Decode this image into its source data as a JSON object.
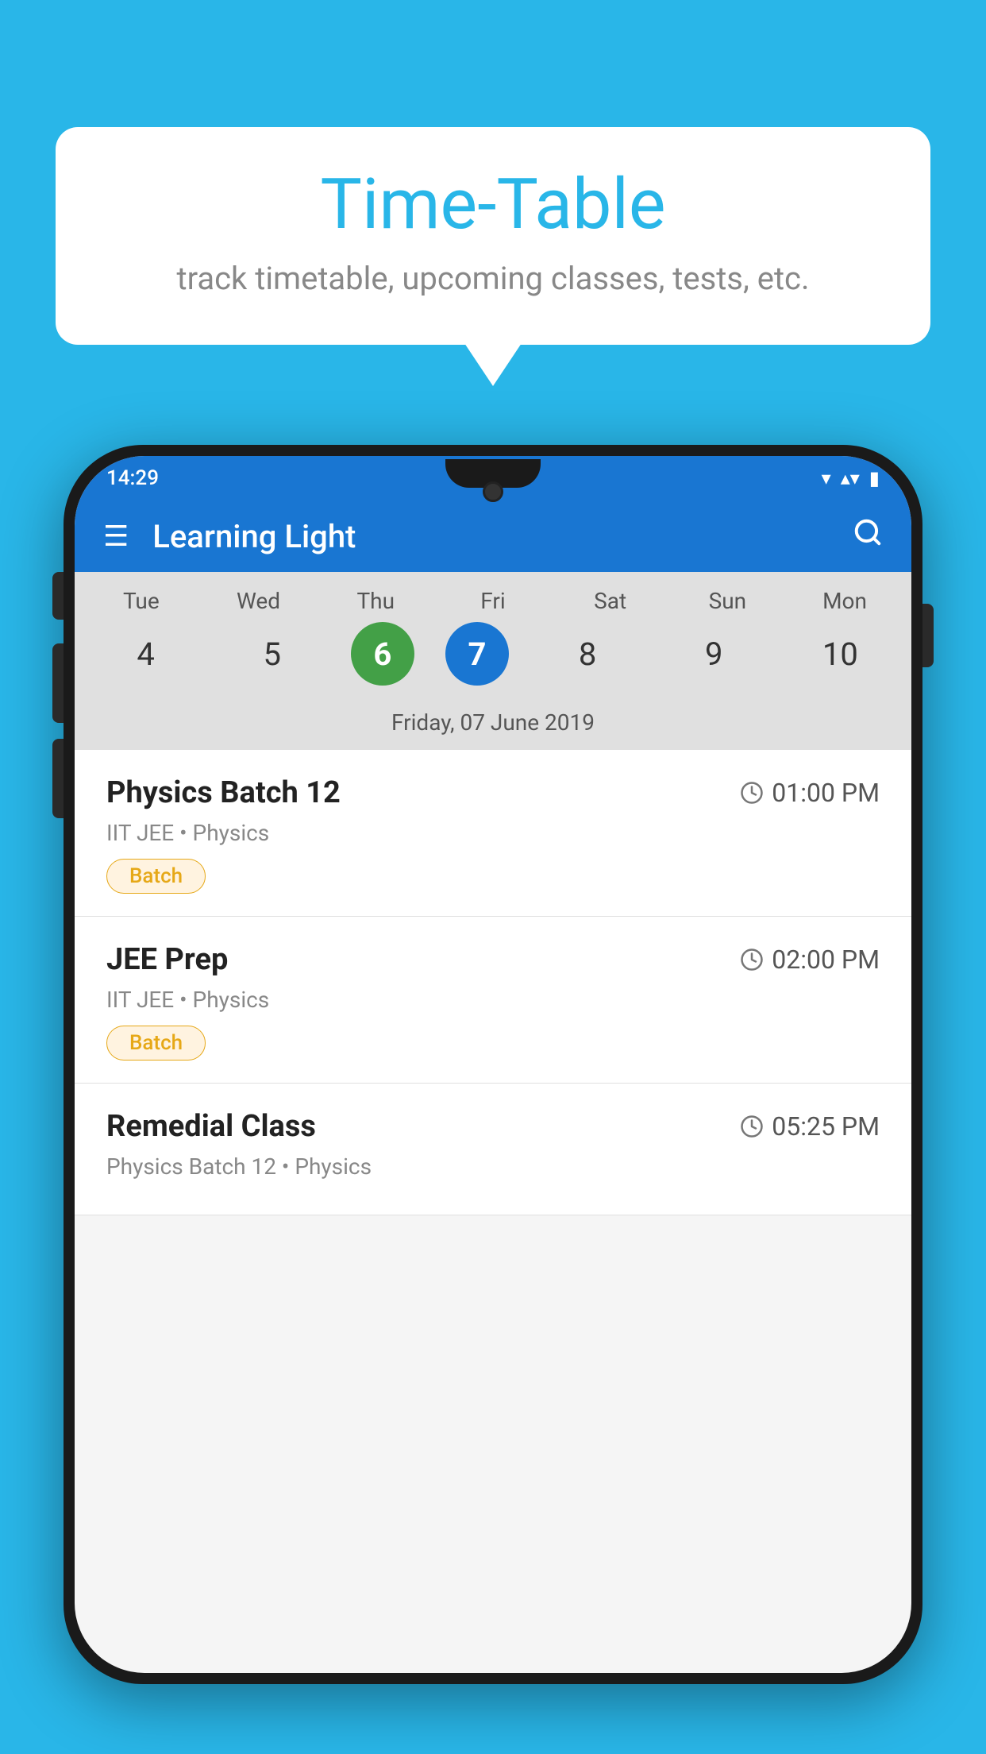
{
  "background_color": "#29b6e8",
  "bubble": {
    "title": "Time-Table",
    "subtitle": "track timetable, upcoming classes, tests, etc."
  },
  "phone": {
    "status_bar": {
      "time": "14:29",
      "signal_icon": "▼▲",
      "battery_icon": "▮"
    },
    "app_bar": {
      "menu_icon": "≡",
      "title": "Learning Light",
      "search_icon": "🔍"
    },
    "calendar": {
      "days": [
        {
          "label": "Tue",
          "num": "4"
        },
        {
          "label": "Wed",
          "num": "5"
        },
        {
          "label": "Thu",
          "num": "6",
          "state": "today"
        },
        {
          "label": "Fri",
          "num": "7",
          "state": "selected"
        },
        {
          "label": "Sat",
          "num": "8"
        },
        {
          "label": "Sun",
          "num": "9"
        },
        {
          "label": "Mon",
          "num": "10"
        }
      ],
      "selected_date_label": "Friday, 07 June 2019"
    },
    "schedule": [
      {
        "name": "Physics Batch 12",
        "time": "01:00 PM",
        "meta": "IIT JEE • Physics",
        "badge": "Batch"
      },
      {
        "name": "JEE Prep",
        "time": "02:00 PM",
        "meta": "IIT JEE • Physics",
        "badge": "Batch"
      },
      {
        "name": "Remedial Class",
        "time": "05:25 PM",
        "meta": "Physics Batch 12 • Physics",
        "badge": ""
      }
    ]
  }
}
